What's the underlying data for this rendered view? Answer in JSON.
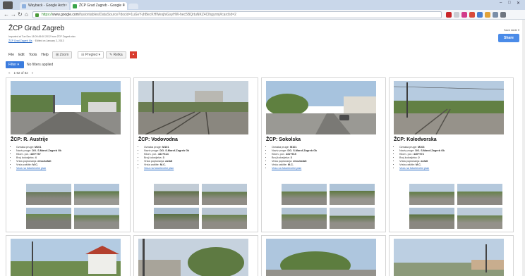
{
  "browser": {
    "tabs": [
      {
        "label": "Wayback - Google Arch",
        "active": false
      },
      {
        "label": "ŽCP Grad Zagreb - Google F",
        "active": true
      }
    ],
    "url_scheme": "https://",
    "url_host": "www.google.com",
    "url_rest": "/fusiontables/DataSource?docid=1uGvY-jhBecKHWesjhiGsyHW-hec5BQrtuNKZ4Clhgyrmj#card:id=2",
    "window_controls": [
      "–",
      "□",
      "✕"
    ]
  },
  "header": {
    "title": "ŽCP Grad Zagreb",
    "meta1": "Imported at Tue Dec 18 09:45:00 2012 from ŽCP Zagreb.xlsx",
    "meta_link": "ŽCP Grad Zagreb Xls",
    "meta2": "Edited on January 2, 2013",
    "share_label": "Share",
    "account_text": "Save table ▾"
  },
  "menu": [
    "File",
    "Edit",
    "Tools",
    "Help"
  ],
  "toolbar": {
    "zoom": "⊞ Zoom",
    "view": "☷ Pregled ▾",
    "rows": "✎ Retka"
  },
  "filter": {
    "button": "Filter ▾",
    "text": "No filters applied"
  },
  "pager": {
    "prev": "«",
    "range": "1-82 of 82",
    "next": "»"
  },
  "cards": [
    {
      "title": "ŽCP: R. Austrije",
      "fields": [
        {
          "k": "Oznaka pruge:",
          "v": "M101"
        },
        {
          "k": "Naziv pruge:",
          "v": "DG. S.Marof-Zagreb Gk"
        },
        {
          "k": "Kilom. pol.:",
          "v": "430+757"
        },
        {
          "k": "Broj kolosijeka:",
          "v": "4"
        },
        {
          "k": "Vrsta popločanja:",
          "v": "drvo/asfalt"
        },
        {
          "k": "Vrsta zaštite:",
          "v": "M.C."
        }
      ],
      "link": "Veza na fotoelevelni plan"
    },
    {
      "title": "ŽCP: Vodovodna",
      "fields": [
        {
          "k": "Oznaka pruge:",
          "v": "M101"
        },
        {
          "k": "Naziv pruge:",
          "v": "DG. S.Marof-Zagreb Gk"
        },
        {
          "k": "Kilom. pol.:",
          "v": "431+614"
        },
        {
          "k": "Broj kolosijeka:",
          "v": "3"
        },
        {
          "k": "Vrsta popločanja:",
          "v": "asfalt"
        },
        {
          "k": "Vrsta zaštite:",
          "v": "M.C."
        }
      ],
      "link": "Veza na fotoelevelni plan"
    },
    {
      "title": "ŽCP: Sokolska",
      "fields": [
        {
          "k": "Oznaka pruge:",
          "v": "M101"
        },
        {
          "k": "Naziv pruge:",
          "v": "DG. S.Marof-Zagreb Gk"
        },
        {
          "k": "Kilom. pol.:",
          "v": "431+915"
        },
        {
          "k": "Broj kolosijeka:",
          "v": "3"
        },
        {
          "k": "Vrsta popločanja:",
          "v": "drvo/asfalt"
        },
        {
          "k": "Vrsta zaštite:",
          "v": "M.C."
        }
      ],
      "link": "Veza na fotoelevelni plan"
    },
    {
      "title": "ŽCP: Kolodvorska",
      "fields": [
        {
          "k": "Oznaka pruge:",
          "v": "M103"
        },
        {
          "k": "Naziv pruge:",
          "v": "DG. S.Marof-Zagreb Gk"
        },
        {
          "k": "Kilom. pol.:",
          "v": "440+974"
        },
        {
          "k": "Broj kolosijeka:",
          "v": "2"
        },
        {
          "k": "Vrsta popločanja:",
          "v": "asfalt"
        },
        {
          "k": "Vrsta zaštite:",
          "v": "M.C."
        }
      ],
      "link": "Veza na fotoelevelni plan"
    }
  ],
  "colors": {
    "accent": "#3b7cde",
    "link": "#1a5fbf",
    "red_button": "#d93b2d"
  },
  "icons": [
    "back-arrow-icon",
    "forward-arrow-icon",
    "reload-icon",
    "home-icon",
    "lock-icon",
    "gmail-icon",
    "wrench-icon"
  ]
}
